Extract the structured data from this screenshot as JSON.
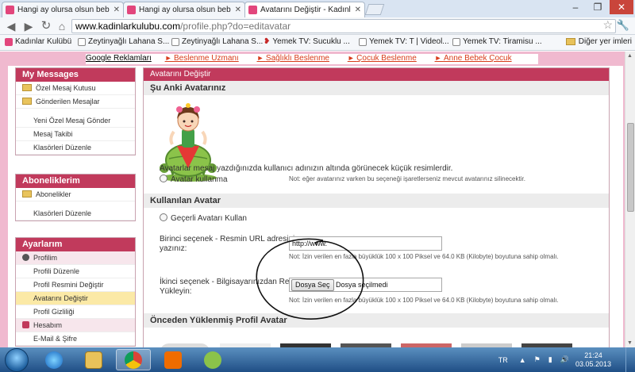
{
  "browser": {
    "tabs": [
      {
        "title": "Hangi ay olursa olsun beb"
      },
      {
        "title": "Hangi ay olursa olsun beb"
      },
      {
        "title": "Avatarını Değiştir - Kadınl"
      }
    ],
    "url_host": "www.kadinlarkulubu.com",
    "url_path": "/profile.php?do=editavatar",
    "bookmarks": [
      {
        "label": "Kadınlar Kulübü",
        "icon": "pink-favicon"
      },
      {
        "label": "Zeytinyağlı Lahana S...",
        "icon": "page-favicon"
      },
      {
        "label": "Zeytinyağlı Lahana S...",
        "icon": "page-favicon"
      },
      {
        "label": "Yemek TV: Sucuklu ...",
        "icon": "heart-favicon"
      },
      {
        "label": "Yemek TV: T | Videol...",
        "icon": "page-favicon"
      },
      {
        "label": "Yemek TV: Tiramisu ...",
        "icon": "page-favicon"
      }
    ],
    "other_bookmarks": "Diğer yer imleri"
  },
  "ads": {
    "google": "Google Reklamları",
    "links": [
      "Beslenme Uzmanı",
      "Sağlıklı Beslenme",
      "Çocuk Beslenme",
      "Anne Bebek Çocuk"
    ]
  },
  "sidebar": {
    "messages": {
      "title": "My Messages",
      "items": [
        "Özel Mesaj Kutusu",
        "Gönderilen Mesajlar",
        "Yeni Özel Mesaj Gönder",
        "Mesaj Takibi",
        "Klasörleri Düzenle"
      ]
    },
    "subscriptions": {
      "title": "Aboneliklerim",
      "items": [
        "Abonelikler",
        "Klasörleri Düzenle"
      ]
    },
    "settings": {
      "title": "Ayarlarım",
      "profile_group": "Profilim",
      "profile_items": [
        "Profili Düzenle",
        "Profil Resmini Değiştir",
        "Avatarını Değiştir",
        "Profil Gizliliği"
      ],
      "account_group": "Hesabım",
      "account_items": [
        "E-Mail & Şifre"
      ]
    }
  },
  "main": {
    "title": "Avatarını Değiştir",
    "current_heading": "Şu Anki Avatarınız",
    "avatar_desc": "Avatarlar mesaj yazdığınızda kullanıcı adınızın altında görünecek küçük resimlerdir.",
    "no_avatar_label": "Avatar kullanma",
    "no_avatar_note": "Not: eğer avatarınız varken bu seçeneği işaretlerseniz mevcut avatarınız silinecektir.",
    "used_heading": "Kullanılan Avatar",
    "use_valid": "Geçerli Avatarı Kullan",
    "option1_label_l1": "Birinci seçenek - Resmin URL adresini",
    "option1_label_l2": "yazınız:",
    "option1_value": "http://www.",
    "option_note": "Not: İzin verilen en fazla büyüklük 100 x 100 Piksel ve 64.0 KB (Kilobyte) boyutuna sahip olmalı.",
    "option2_label_l1": "İkinci seçenek - Bilgisayarınızdan Resim",
    "option2_label_l2": "Yükleyin:",
    "file_button": "Dosya Seç",
    "file_status": "Dosya seçilmedi",
    "previous_heading": "Önceden Yüklenmiş Profil Avatar"
  },
  "taskbar": {
    "lang": "TR",
    "time": "21:24",
    "date": "03.05.2013"
  },
  "colors": {
    "accent": "#c13a5c",
    "pink_bg": "#f0b9cf",
    "ad_link": "#d83b1a"
  }
}
